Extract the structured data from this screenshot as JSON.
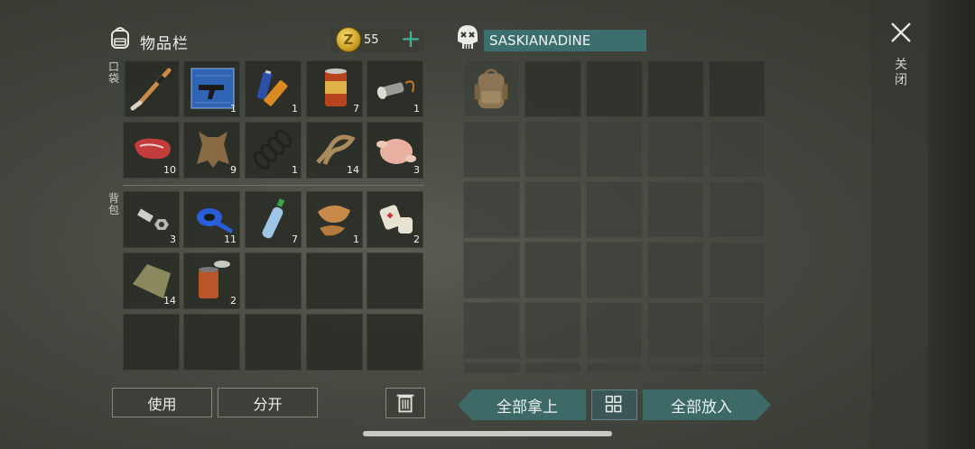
{
  "inventory": {
    "title": "物品栏",
    "coins": "55",
    "coin_symbol": "Z",
    "add_label": "+",
    "pockets_label": "口袋",
    "backpack_label": "背包",
    "pocket_items": [
      {
        "name": "hockey-stick-icon",
        "qty": ""
      },
      {
        "name": "gun-blueprint-icon",
        "qty": "1"
      },
      {
        "name": "batteries-icon",
        "qty": "1"
      },
      {
        "name": "canned-food-icon",
        "qty": "7"
      },
      {
        "name": "flashlight-icon",
        "qty": "1"
      },
      {
        "name": "raw-meat-icon",
        "qty": "10"
      },
      {
        "name": "animal-hide-icon",
        "qty": "9"
      },
      {
        "name": "spring-icon",
        "qty": "1"
      },
      {
        "name": "rope-icon",
        "qty": "14"
      },
      {
        "name": "raw-chicken-icon",
        "qty": "3"
      }
    ],
    "backpack_items": [
      {
        "name": "bolt-nut-icon",
        "qty": "3"
      },
      {
        "name": "duct-tape-icon",
        "qty": "11"
      },
      {
        "name": "water-bottle-icon",
        "qty": "7"
      },
      {
        "name": "leather-scraps-icon",
        "qty": "1"
      },
      {
        "name": "bandage-icon",
        "qty": "2"
      },
      {
        "name": "cloth-icon",
        "qty": "14"
      },
      {
        "name": "open-can-icon",
        "qty": "2"
      }
    ],
    "use_label": "使用",
    "split_label": "分开"
  },
  "loot": {
    "player_name": "SASKIANADINE",
    "take_all_label": "全部拿上",
    "put_all_label": "全部放入"
  },
  "close_label": "关闭"
}
